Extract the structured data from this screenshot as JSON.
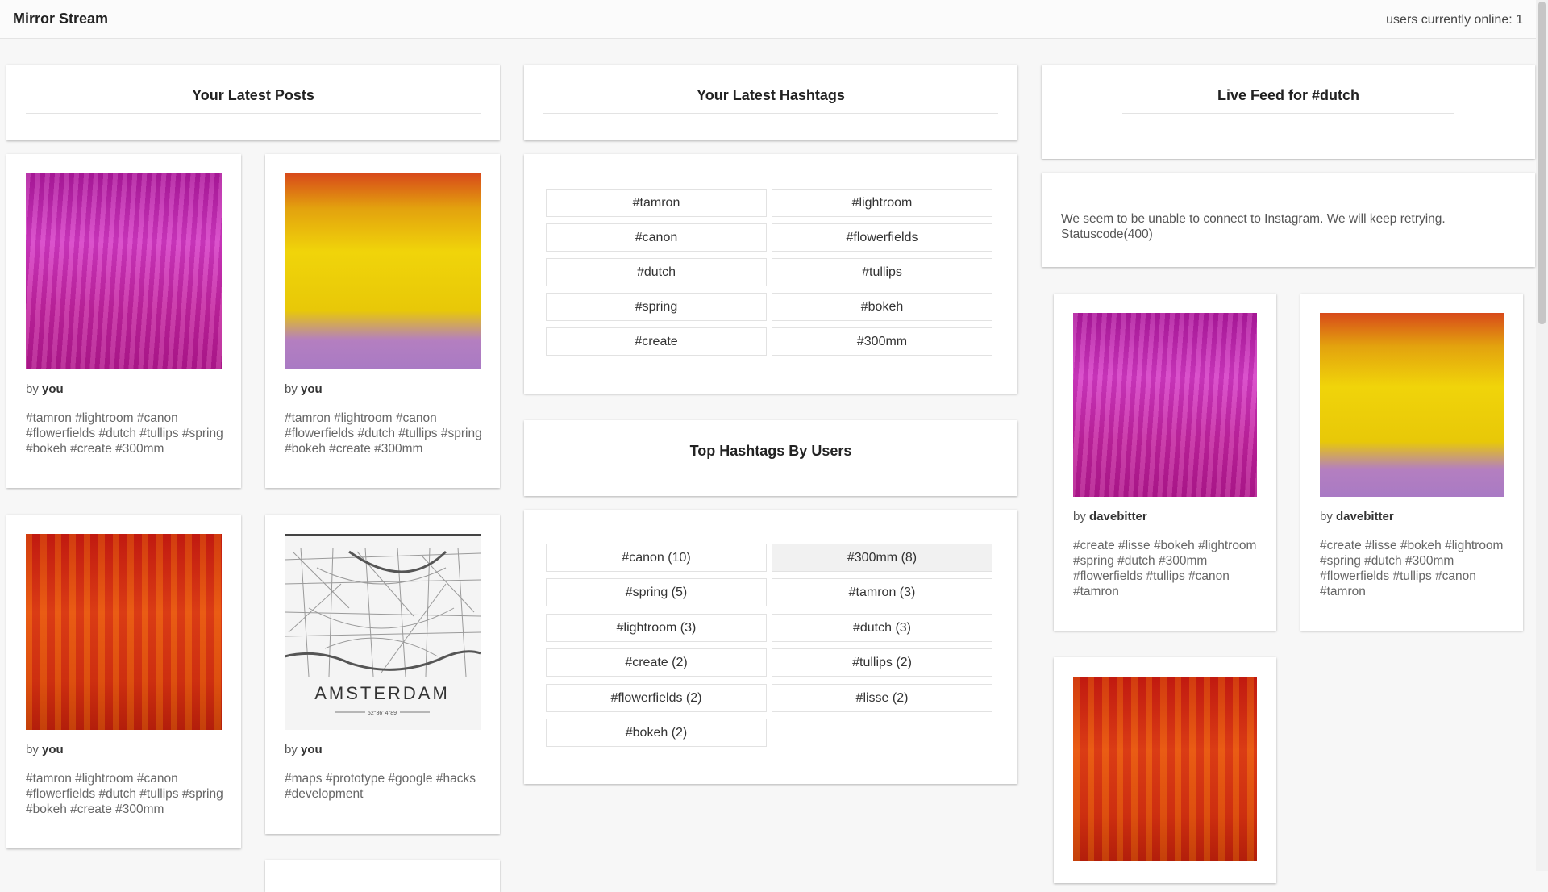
{
  "app": {
    "title": "Mirror Stream",
    "online": "users currently online: 1"
  },
  "columns": {
    "posts_title": "Your Latest Posts",
    "hashtags_title": "Your Latest Hashtags",
    "top_title": "Top Hashtags By Users",
    "feed_title": "Live Feed for #dutch"
  },
  "posts": [
    {
      "by_prefix": "by",
      "author": "you",
      "tags": "#tamron #lightroom #canon #flowerfields #dutch #tullips #spring #bokeh #create #300mm"
    },
    {
      "by_prefix": "by",
      "author": "you",
      "tags": "#tamron #lightroom #canon #flowerfields #dutch #tullips #spring #bokeh #create #300mm"
    },
    {
      "by_prefix": "by",
      "author": "you",
      "tags": "#tamron #lightroom #canon #flowerfields #dutch #tullips #spring #bokeh #create #300mm"
    },
    {
      "by_prefix": "by",
      "author": "you",
      "tags": "#maps #prototype #google #hacks #development",
      "map_label": "AMSTERDAM",
      "map_coords": "52°36' 4°89"
    }
  ],
  "latest_hashtags": [
    "#tamron",
    "#lightroom",
    "#canon",
    "#flowerfields",
    "#dutch",
    "#tullips",
    "#spring",
    "#bokeh",
    "#create",
    "#300mm"
  ],
  "top_hashtags": [
    "#canon (10)",
    "#300mm (8)",
    "#spring (5)",
    "#tamron (3)",
    "#lightroom (3)",
    "#dutch (3)",
    "#create (2)",
    "#tullips (2)",
    "#flowerfields (2)",
    "#lisse (2)",
    "#bokeh (2)"
  ],
  "feed": {
    "error": "We seem to be unable to connect to Instagram. We will keep retrying. Statuscode(400)",
    "items": [
      {
        "by_prefix": "by",
        "author": "davebitter",
        "tags": "#create #lisse #bokeh #lightroom #spring #dutch #300mm #flowerfields #tullips #canon #tamron"
      },
      {
        "by_prefix": "by",
        "author": "davebitter",
        "tags": "#create #lisse #bokeh #lightroom #spring #dutch #300mm #flowerfields #tullips #canon #tamron"
      }
    ]
  }
}
